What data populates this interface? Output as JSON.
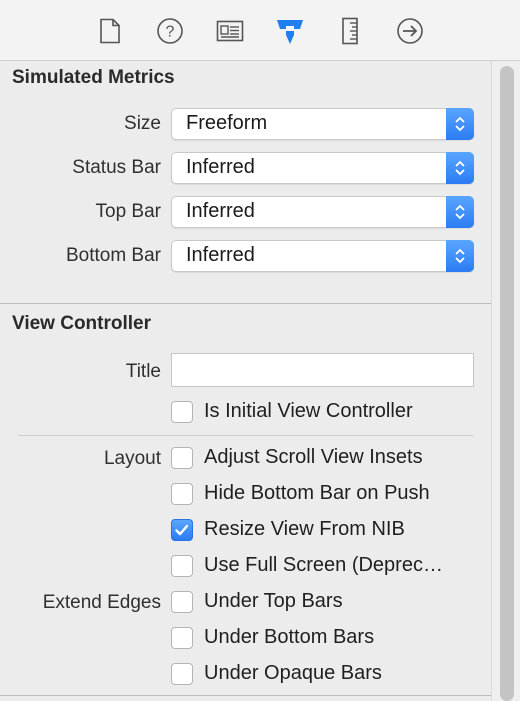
{
  "toolbar": {
    "icons": [
      "file-inspector-icon",
      "quick-help-icon",
      "identity-inspector-icon",
      "attributes-inspector-icon",
      "size-inspector-icon",
      "connections-inspector-icon"
    ]
  },
  "simulated_metrics": {
    "title": "Simulated Metrics",
    "rows": [
      {
        "label": "Size",
        "value": "Freeform"
      },
      {
        "label": "Status Bar",
        "value": "Inferred"
      },
      {
        "label": "Top Bar",
        "value": "Inferred"
      },
      {
        "label": "Bottom Bar",
        "value": "Inferred"
      }
    ]
  },
  "view_controller": {
    "title": "View Controller",
    "title_label": "Title",
    "title_value": "",
    "initial_label": "Is Initial View Controller",
    "initial_checked": false,
    "layout_label": "Layout",
    "layout_options": [
      {
        "label": "Adjust Scroll View Insets",
        "checked": false
      },
      {
        "label": "Hide Bottom Bar on Push",
        "checked": false
      },
      {
        "label": "Resize View From NIB",
        "checked": true
      },
      {
        "label": "Use Full Screen (Deprec…",
        "checked": false
      }
    ],
    "extend_edges_label": "Extend Edges",
    "extend_options": [
      {
        "label": "Under Top Bars",
        "checked": false
      },
      {
        "label": "Under Bottom Bars",
        "checked": false
      },
      {
        "label": "Under Opaque Bars",
        "checked": false
      }
    ]
  },
  "colors": {
    "accent": "#2b7cf4",
    "background": "#ececec"
  }
}
